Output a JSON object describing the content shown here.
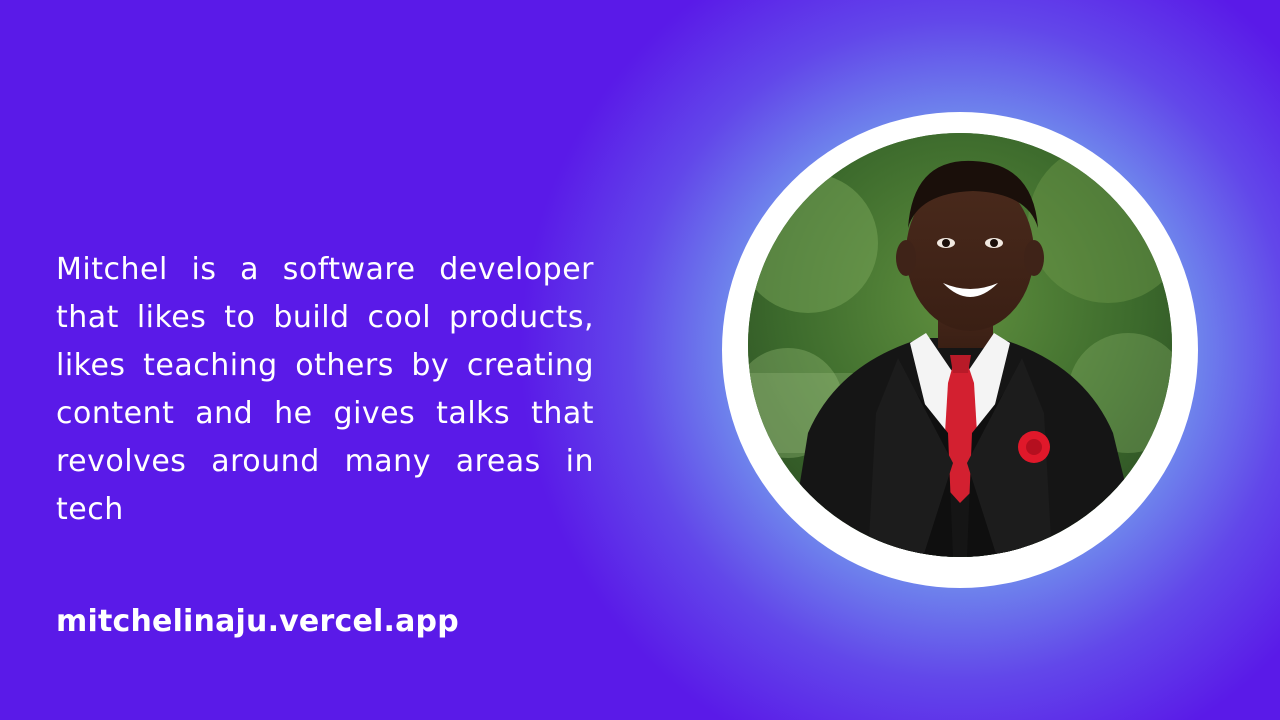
{
  "bio": {
    "text": "Mitchel is a software developer that likes to build cool products, likes teaching others by creating content and he gives talks that revolves around many areas in tech"
  },
  "website": {
    "label": "mitchelinaju.vercel.app"
  },
  "colors": {
    "background": "#5a1ae8",
    "glow": "#a9dbe8",
    "text": "#ffffff",
    "ring": "#ffffff",
    "tie": "#d32030",
    "rose": "#e0182a"
  }
}
